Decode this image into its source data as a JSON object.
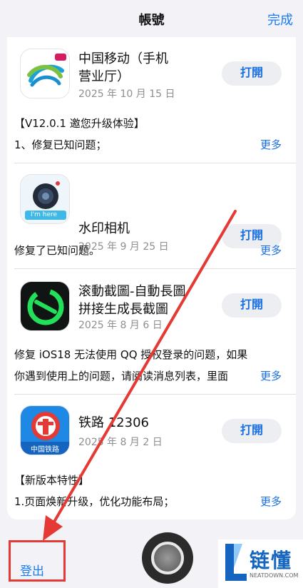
{
  "nav": {
    "title": "帳號",
    "done_label": "完成"
  },
  "apps": [
    {
      "name": "中国移动（手机营业厅）",
      "name_line1": "中国移动（手机",
      "name_line2": "营业厅）",
      "date": "2025 年 10 月 15 日",
      "open_label": "打開",
      "notes_line1": "【V12.0.1 邀您升级体验】",
      "notes_line2": "1、修复已知问题；",
      "more_label": "更多",
      "icon": "china-mobile-icon"
    },
    {
      "name_line1": "水印相机",
      "date": "2025 年 9 月 25 日",
      "open_label": "打開",
      "notes_line1": "修复了已知问题。",
      "more_label": "更多",
      "icon": "watermark-camera-icon",
      "icon_text": "I'm here"
    },
    {
      "name_line1": "滚動截圖-自動長圖",
      "name_line2": "拼接生成長截圖",
      "date": "2025 年 8 月 6 日",
      "open_label": "打開",
      "notes_line1": "修复 iOS18 无法使用 QQ 授权登录的问题，如果",
      "notes_line2": "你遇到使用上的问题，请阅读消息列表，里面",
      "more_label": "更多",
      "icon": "scroll-screenshot-icon"
    },
    {
      "name_line1": "铁路 12306",
      "date": "2025 年 8 月 2 日",
      "open_label": "打開",
      "notes_line1": "【新版本特性】",
      "notes_line2": "1.页面焕新升级，优化功能布局；",
      "more_label": "更多",
      "icon": "railway-12306-icon",
      "icon_text": "中国铁路"
    }
  ],
  "footer": {
    "logout_label": "登出"
  },
  "watermark": {
    "brand": "链懂",
    "site": "NEATDOWN.COM"
  },
  "colors": {
    "accent": "#1a7cf5",
    "annotation": "#e53935"
  }
}
